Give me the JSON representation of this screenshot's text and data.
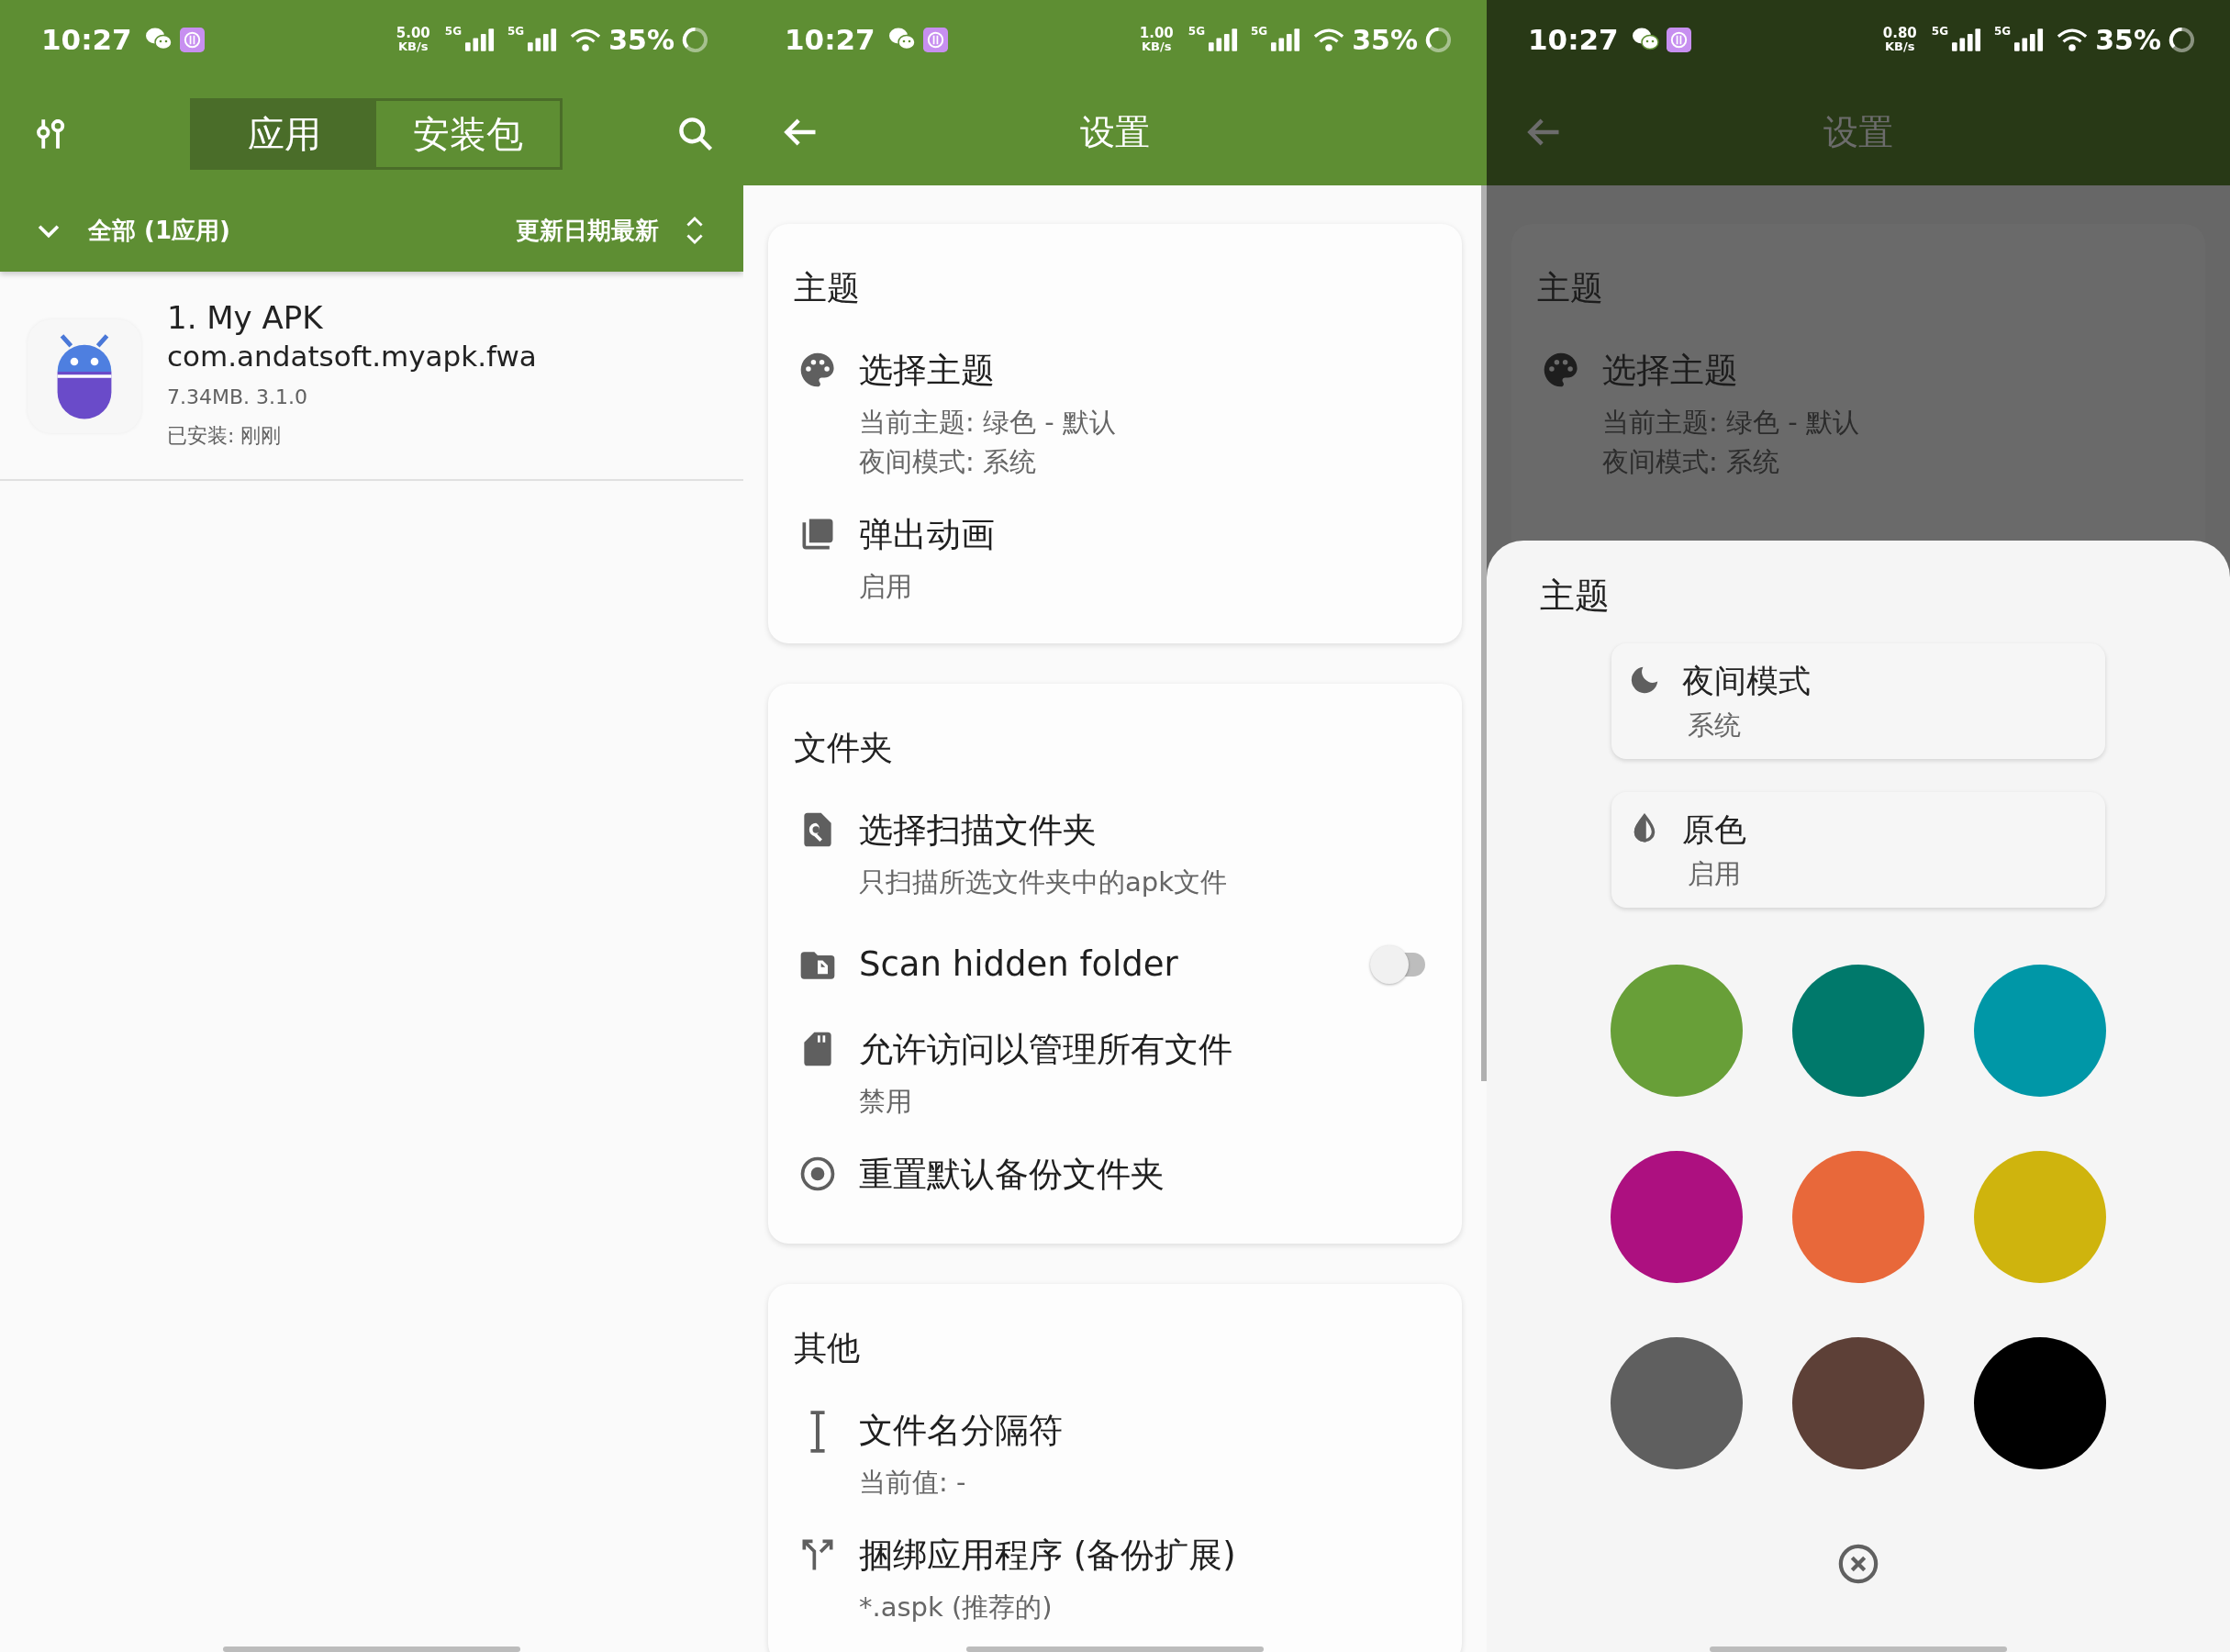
{
  "app_list_screen": {
    "status_bar": {
      "time": "10:27",
      "speed": "5.00",
      "speed_unit": "KB/s",
      "networks": [
        "5G",
        "5G"
      ],
      "battery": "35%"
    },
    "tabs": [
      {
        "label": "应用",
        "selected": true
      },
      {
        "label": "安装包",
        "selected": false
      }
    ],
    "filter": {
      "label": "全部 (1应用)",
      "sort": "更新日期最新"
    },
    "apps": [
      {
        "title": "1. My APK",
        "package": "com.andatsoft.myapk.fwa",
        "details": "7.34MB. 3.1.0",
        "installed": "已安装: 刚刚"
      }
    ]
  },
  "settings_screen": {
    "status_bar": {
      "time": "10:27",
      "speed": "1.00",
      "speed_unit": "KB/s",
      "networks": [
        "5G",
        "5G"
      ],
      "battery": "35%"
    },
    "title": "设置",
    "sections": [
      {
        "header": "主题",
        "items": [
          {
            "kind": "item",
            "title": "选择主题",
            "subtitles": [
              "当前主题: 绿色 - 默认",
              "夜间模式: 系统"
            ]
          },
          {
            "kind": "item",
            "title": "弹出动画",
            "subtitles": [
              "启用"
            ]
          }
        ]
      },
      {
        "header": "文件夹",
        "items": [
          {
            "kind": "item",
            "title": "选择扫描文件夹",
            "subtitles": [
              "只扫描所选文件夹中的apk文件"
            ]
          },
          {
            "kind": "toggle",
            "title": "Scan hidden folder",
            "on": false
          },
          {
            "kind": "item",
            "title": "允许访问以管理所有文件",
            "subtitles": [
              "禁用"
            ]
          },
          {
            "kind": "item",
            "title": "重置默认备份文件夹"
          }
        ]
      },
      {
        "header": "其他",
        "items": [
          {
            "kind": "item",
            "title": "文件名分隔符",
            "subtitles": [
              "当前值: -"
            ]
          },
          {
            "kind": "item",
            "title": "捆绑应用程序 (备份扩展)",
            "subtitles": [
              "*.aspk (推荐的)"
            ]
          }
        ]
      }
    ]
  },
  "theme_dialog_screen": {
    "status_bar": {
      "time": "10:27",
      "speed": "0.80",
      "speed_unit": "KB/s",
      "networks": [
        "5G",
        "5G"
      ],
      "battery": "35%"
    },
    "title": "设置",
    "background_section": {
      "header": "主题",
      "items": [
        {
          "title": "选择主题",
          "subtitles": [
            "当前主题: 绿色 - 默认",
            "夜间模式: 系统"
          ]
        }
      ]
    },
    "dialog": {
      "title": "主题",
      "options": [
        {
          "title": "夜间模式",
          "value": "系统"
        },
        {
          "title": "原色",
          "value": "启用"
        }
      ],
      "swatches": [
        {
          "color": "#689f38"
        },
        {
          "color": "#00796b"
        },
        {
          "color": "#0097a7"
        },
        {
          "color": "#ad1080"
        },
        {
          "color": "#e8683a"
        },
        {
          "color": "#cfb40d"
        },
        {
          "color": "#5f5f5f"
        },
        {
          "color": "#5d4037"
        },
        {
          "color": "#000000"
        }
      ]
    }
  }
}
